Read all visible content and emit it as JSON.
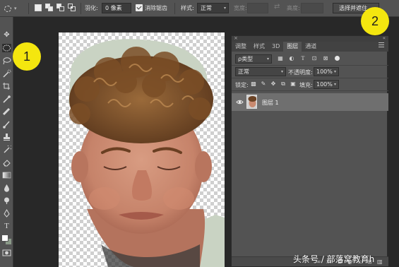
{
  "options_bar": {
    "feather_label": "羽化:",
    "feather_value": "0 像素",
    "antialias_label": "消除锯齿",
    "style_label": "样式:",
    "style_value": "正常",
    "width_label": "宽度:",
    "height_label": "高度:",
    "select_mask_button": "选择并遮住..."
  },
  "callouts": {
    "one": "1",
    "two": "2"
  },
  "layers_panel": {
    "tabs": [
      "调整",
      "样式",
      "3D",
      "图层",
      "通道"
    ],
    "active_tab": "图层",
    "filter_kind": "ρ类型",
    "blend_mode": "正常",
    "opacity_label": "不透明度:",
    "opacity_value": "100%",
    "lock_label": "锁定:",
    "fill_label": "填充:",
    "fill_value": "100%",
    "layers": [
      {
        "name": "图层 1",
        "visible": true
      }
    ]
  },
  "watermark": "头条号 / 部落窝教育h",
  "colors": {
    "ui_panel": "#535353",
    "workspace": "#282828",
    "callout": "#f4e60f",
    "selected_layer": "#6f6f6f"
  }
}
